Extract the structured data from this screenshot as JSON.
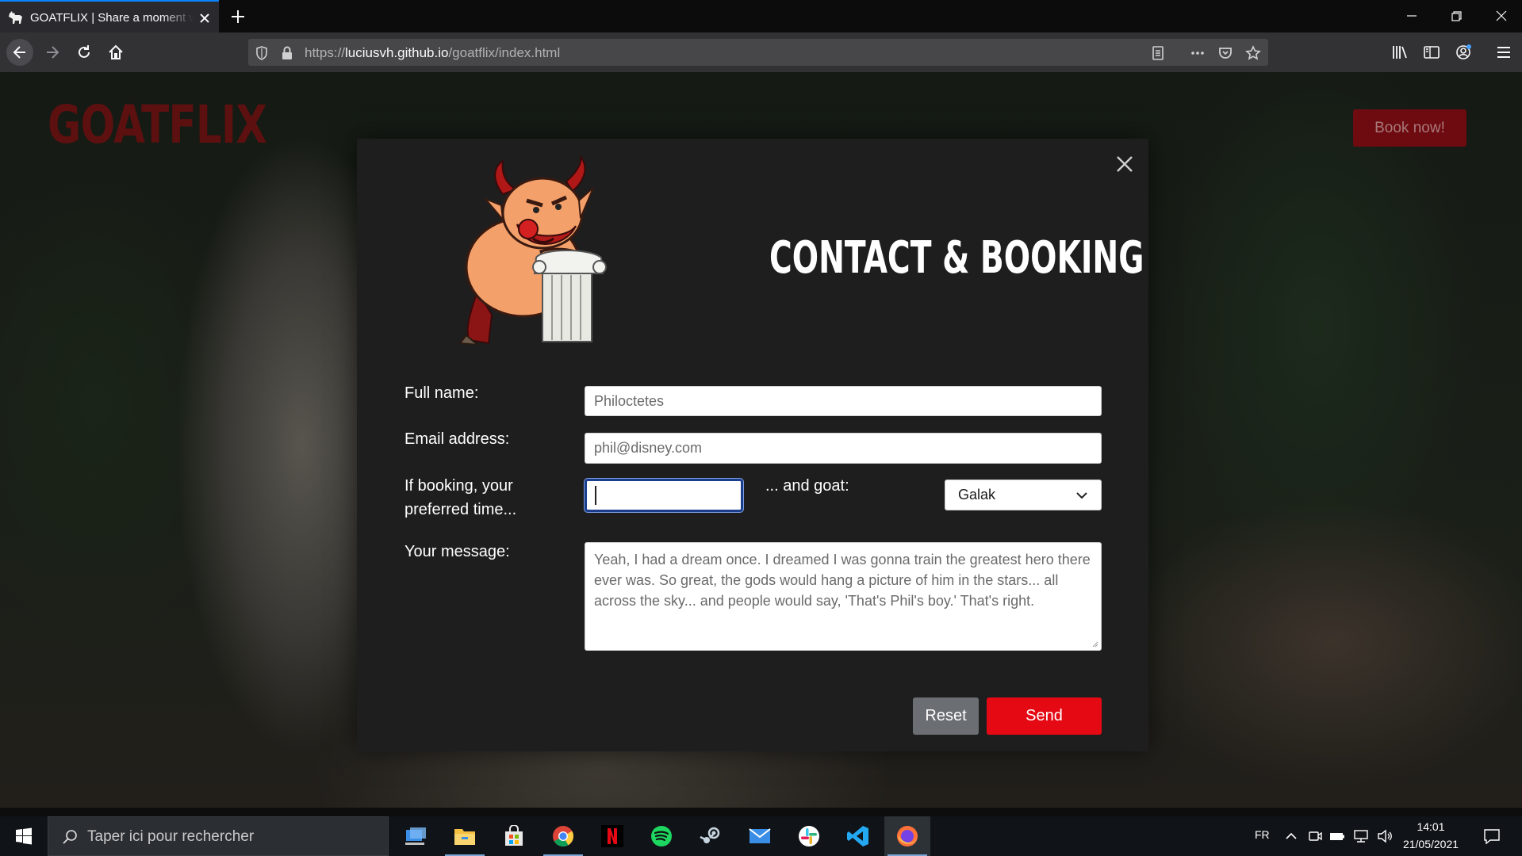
{
  "browser": {
    "tab_title": "GOATFLIX | Share a moment with a goat",
    "url_scheme": "https://",
    "url_host": "luciusvh.github.io",
    "url_path": "/goatflix/index.html",
    "accent_color": "#0a84ff"
  },
  "site": {
    "logo": "GOATFLIX",
    "book_button": "Book now!",
    "brand_color": "#e50914"
  },
  "modal": {
    "title": "CONTACT & BOOKING",
    "fields": {
      "name_label": "Full name:",
      "name_value": "Philoctetes",
      "email_label": "Email address:",
      "email_value": "phil@disney.com",
      "time_label": "If booking, your preferred time...",
      "time_value": "",
      "goat_label": "... and goat:",
      "goat_value": "Galak",
      "message_label": "Your message:",
      "message_value": "Yeah, I had a dream once. I dreamed I was gonna train the greatest hero there ever was. So great, the gods would hang a picture of him in the stars... all across the sky... and people would say, 'That's Phil's boy.' That's right."
    },
    "reset_button": "Reset",
    "send_button": "Send"
  },
  "taskbar": {
    "search_placeholder": "Taper ici pour rechercher",
    "apps": [
      "desktop-icon",
      "file-explorer-icon",
      "store-icon",
      "chrome-icon",
      "netflix-icon",
      "spotify-icon",
      "steam-icon",
      "mail-icon",
      "slack-icon",
      "vscode-icon",
      "firefox-icon"
    ],
    "language": "FR",
    "time": "14:01",
    "date": "21/05/2021"
  }
}
